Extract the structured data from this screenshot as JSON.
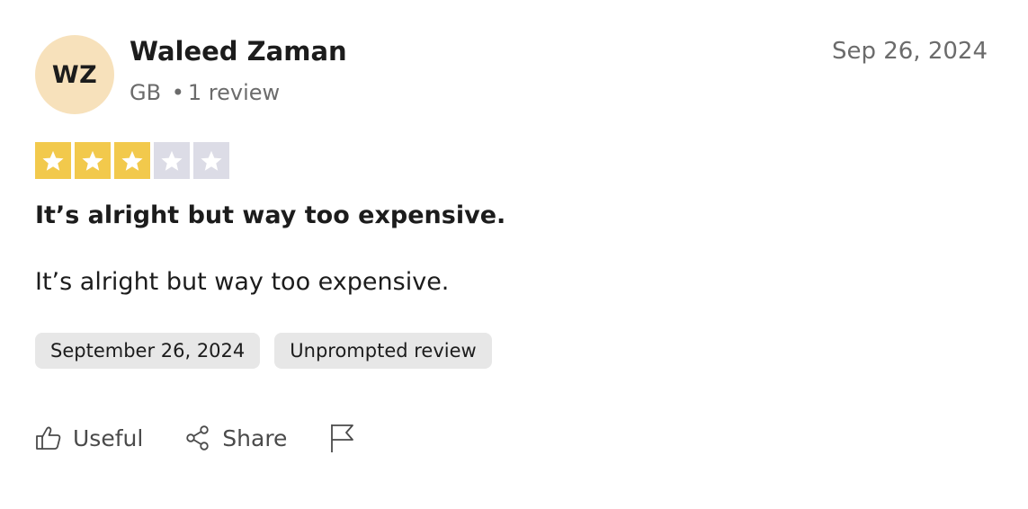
{
  "reviewer": {
    "initials": "WZ",
    "name": "Waleed Zaman",
    "country": "GB",
    "separator": "•",
    "review_count": "1 review"
  },
  "review": {
    "date": "Sep 26, 2024",
    "rating": 3,
    "rating_max": 5,
    "title": "It’s alright but way too expensive.",
    "body": "It’s alright but way too expensive."
  },
  "tags": [
    "September 26, 2024",
    "Unprompted review"
  ],
  "actions": {
    "useful_label": "Useful",
    "share_label": "Share"
  },
  "icons": {
    "useful": "thumbs-up-icon",
    "share": "share-icon",
    "report": "flag-icon",
    "star": "star-icon"
  },
  "colors": {
    "star_filled": "#f2c94c",
    "star_empty": "#dcdce6",
    "avatar_bg": "#f7e1bb",
    "tag_bg": "#e7e7e7"
  }
}
